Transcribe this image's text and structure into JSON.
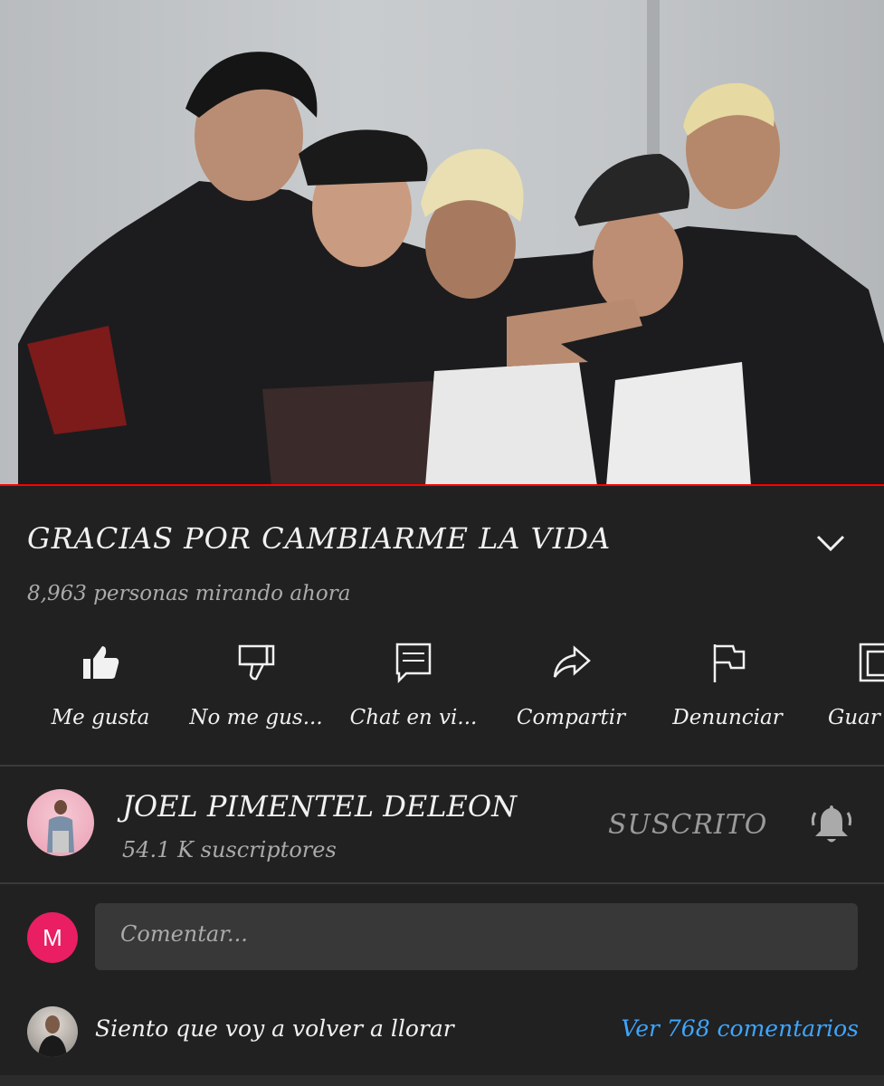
{
  "video": {
    "progress_fraction": 1.0,
    "thumbnail_description_icon": "video-frame"
  },
  "title": "GRACIAS POR CAMBIARME LA VIDA",
  "viewers": "8,963 personas mirando ahora",
  "actions": [
    {
      "icon": "thumbs-up-icon",
      "label": "Me gusta"
    },
    {
      "icon": "thumbs-down-icon",
      "label": "No me gus..."
    },
    {
      "icon": "chat-icon",
      "label": "Chat en vi..."
    },
    {
      "icon": "share-icon",
      "label": "Compartir"
    },
    {
      "icon": "flag-icon",
      "label": "Denunciar"
    },
    {
      "icon": "save-icon",
      "label": "Guar"
    }
  ],
  "channel": {
    "name": "JOEL PIMENTEL DELEON",
    "subscribers": "54.1 K suscriptores",
    "subscribe_state": "SUSCRITO"
  },
  "comment_input": {
    "avatar_letter": "M",
    "placeholder": "Comentar..."
  },
  "top_comment": {
    "text": "Siento que voy a volver a llorar",
    "view_all": "Ver 768 comentarios"
  },
  "colors": {
    "background": "#212121",
    "progress": "#ff0000",
    "link": "#3ea6ff",
    "avatar": "#e91e63"
  }
}
